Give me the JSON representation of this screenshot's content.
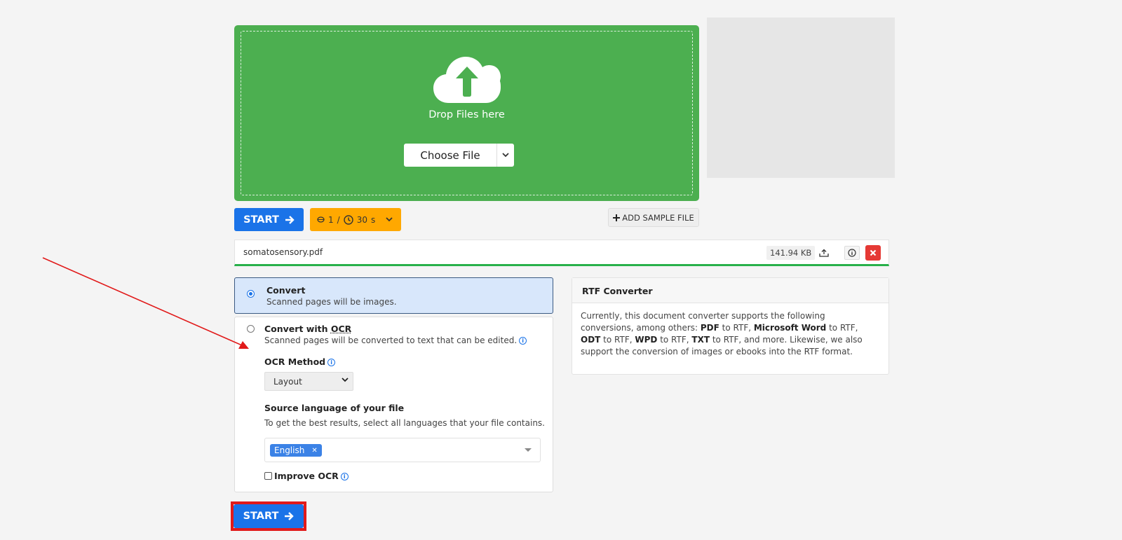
{
  "dropzone": {
    "drop_text": "Drop Files here",
    "choose_file_label": "Choose File",
    "bg_color": "#4caf50"
  },
  "toolbar": {
    "start_label": "START",
    "credits_count": "1",
    "credits_separator": "/",
    "time_value": "30",
    "time_unit": "s",
    "add_sample_label": "ADD SAMPLE FILE",
    "start_color": "#1a73e8",
    "credits_color": "#ffa800"
  },
  "file": {
    "name": "somatosensory.pdf",
    "size": "141.94 KB",
    "progress_percent": 100,
    "progress_color": "#28b04a"
  },
  "options": {
    "convert": {
      "title": "Convert",
      "description": "Scanned pages will be images.",
      "selected": true
    },
    "convert_ocr": {
      "title_prefix": "Convert with ",
      "title_abbr": "OCR",
      "description": "Scanned pages will be converted to text that can be edited.",
      "selected": false,
      "ocr_method_label": "OCR Method",
      "ocr_method_value": "Layout",
      "source_language_label": "Source language of your file",
      "source_language_hint": "To get the best results, select all languages that your file contains.",
      "languages": [
        "English"
      ],
      "improve_ocr_label": "Improve OCR",
      "improve_ocr_checked": false
    }
  },
  "info_card": {
    "title": "RTF Converter",
    "body_parts": [
      {
        "t": "Currently, this document converter supports the following conversions, among others: ",
        "b": false
      },
      {
        "t": "PDF",
        "b": true
      },
      {
        "t": " to RTF, ",
        "b": false
      },
      {
        "t": "Microsoft Word",
        "b": true
      },
      {
        "t": " to RTF, ",
        "b": false
      },
      {
        "t": "ODT",
        "b": true
      },
      {
        "t": " to RTF, ",
        "b": false
      },
      {
        "t": "WPD",
        "b": true
      },
      {
        "t": " to RTF, ",
        "b": false
      },
      {
        "t": "TXT",
        "b": true
      },
      {
        "t": " to RTF, and more. Likewise, we also support the conversion of images or ebooks into the RTF format.",
        "b": false
      }
    ]
  },
  "annotation": {
    "arrow_color": "#e11a1a",
    "highlight_color": "#e11a1a"
  },
  "bottom": {
    "start_label": "START"
  }
}
